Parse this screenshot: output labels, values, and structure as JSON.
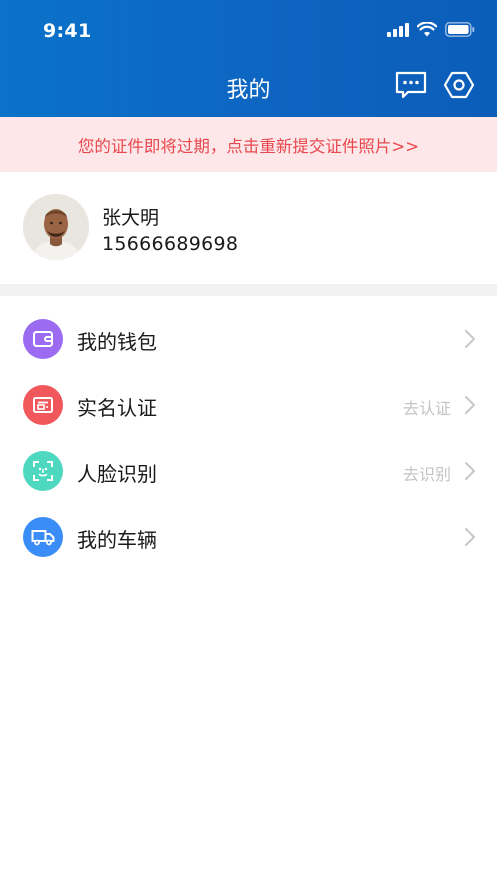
{
  "status_bar": {
    "time": "9:41"
  },
  "header": {
    "title": "我的"
  },
  "notice": {
    "text": "您的证件即将过期，点击重新提交证件照片>>"
  },
  "profile": {
    "name": "张大明",
    "phone": "15666689698"
  },
  "menu": {
    "items": [
      {
        "label": "我的钱包",
        "hint": "",
        "icon": "wallet-icon",
        "color": "#9b6cf2"
      },
      {
        "label": "实名认证",
        "hint": "去认证",
        "icon": "id-card-icon",
        "color": "#f0585c"
      },
      {
        "label": "人脸识别",
        "hint": "去识别",
        "icon": "face-scan-icon",
        "color": "#4fd8c0"
      },
      {
        "label": "我的车辆",
        "hint": "",
        "icon": "truck-icon",
        "color": "#3a8df6"
      }
    ]
  },
  "colors": {
    "header": "#0b66c2",
    "notice_bg": "#fde7e8",
    "notice_text": "#e8484f"
  }
}
